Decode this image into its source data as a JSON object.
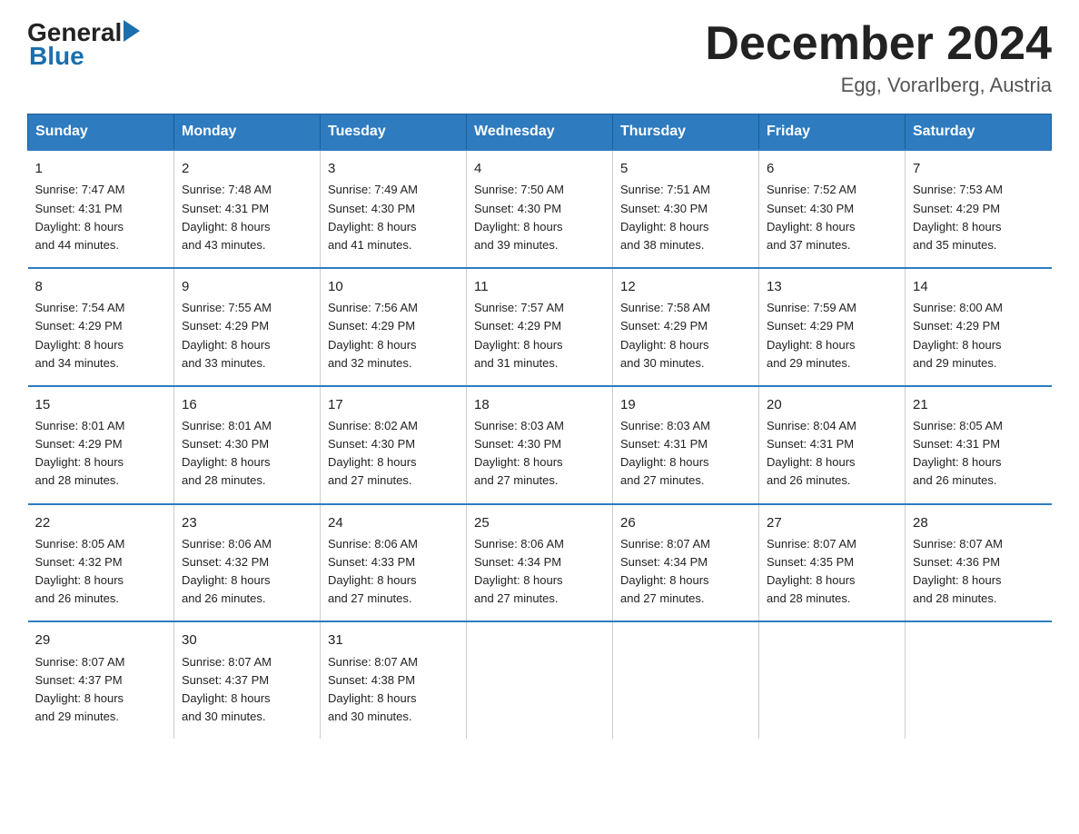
{
  "logo": {
    "general": "General",
    "arrow": "",
    "blue": "Blue"
  },
  "title": "December 2024",
  "location": "Egg, Vorarlberg, Austria",
  "days_of_week": [
    "Sunday",
    "Monday",
    "Tuesday",
    "Wednesday",
    "Thursday",
    "Friday",
    "Saturday"
  ],
  "weeks": [
    [
      {
        "day": "1",
        "info": "Sunrise: 7:47 AM\nSunset: 4:31 PM\nDaylight: 8 hours\nand 44 minutes."
      },
      {
        "day": "2",
        "info": "Sunrise: 7:48 AM\nSunset: 4:31 PM\nDaylight: 8 hours\nand 43 minutes."
      },
      {
        "day": "3",
        "info": "Sunrise: 7:49 AM\nSunset: 4:30 PM\nDaylight: 8 hours\nand 41 minutes."
      },
      {
        "day": "4",
        "info": "Sunrise: 7:50 AM\nSunset: 4:30 PM\nDaylight: 8 hours\nand 39 minutes."
      },
      {
        "day": "5",
        "info": "Sunrise: 7:51 AM\nSunset: 4:30 PM\nDaylight: 8 hours\nand 38 minutes."
      },
      {
        "day": "6",
        "info": "Sunrise: 7:52 AM\nSunset: 4:30 PM\nDaylight: 8 hours\nand 37 minutes."
      },
      {
        "day": "7",
        "info": "Sunrise: 7:53 AM\nSunset: 4:29 PM\nDaylight: 8 hours\nand 35 minutes."
      }
    ],
    [
      {
        "day": "8",
        "info": "Sunrise: 7:54 AM\nSunset: 4:29 PM\nDaylight: 8 hours\nand 34 minutes."
      },
      {
        "day": "9",
        "info": "Sunrise: 7:55 AM\nSunset: 4:29 PM\nDaylight: 8 hours\nand 33 minutes."
      },
      {
        "day": "10",
        "info": "Sunrise: 7:56 AM\nSunset: 4:29 PM\nDaylight: 8 hours\nand 32 minutes."
      },
      {
        "day": "11",
        "info": "Sunrise: 7:57 AM\nSunset: 4:29 PM\nDaylight: 8 hours\nand 31 minutes."
      },
      {
        "day": "12",
        "info": "Sunrise: 7:58 AM\nSunset: 4:29 PM\nDaylight: 8 hours\nand 30 minutes."
      },
      {
        "day": "13",
        "info": "Sunrise: 7:59 AM\nSunset: 4:29 PM\nDaylight: 8 hours\nand 29 minutes."
      },
      {
        "day": "14",
        "info": "Sunrise: 8:00 AM\nSunset: 4:29 PM\nDaylight: 8 hours\nand 29 minutes."
      }
    ],
    [
      {
        "day": "15",
        "info": "Sunrise: 8:01 AM\nSunset: 4:29 PM\nDaylight: 8 hours\nand 28 minutes."
      },
      {
        "day": "16",
        "info": "Sunrise: 8:01 AM\nSunset: 4:30 PM\nDaylight: 8 hours\nand 28 minutes."
      },
      {
        "day": "17",
        "info": "Sunrise: 8:02 AM\nSunset: 4:30 PM\nDaylight: 8 hours\nand 27 minutes."
      },
      {
        "day": "18",
        "info": "Sunrise: 8:03 AM\nSunset: 4:30 PM\nDaylight: 8 hours\nand 27 minutes."
      },
      {
        "day": "19",
        "info": "Sunrise: 8:03 AM\nSunset: 4:31 PM\nDaylight: 8 hours\nand 27 minutes."
      },
      {
        "day": "20",
        "info": "Sunrise: 8:04 AM\nSunset: 4:31 PM\nDaylight: 8 hours\nand 26 minutes."
      },
      {
        "day": "21",
        "info": "Sunrise: 8:05 AM\nSunset: 4:31 PM\nDaylight: 8 hours\nand 26 minutes."
      }
    ],
    [
      {
        "day": "22",
        "info": "Sunrise: 8:05 AM\nSunset: 4:32 PM\nDaylight: 8 hours\nand 26 minutes."
      },
      {
        "day": "23",
        "info": "Sunrise: 8:06 AM\nSunset: 4:32 PM\nDaylight: 8 hours\nand 26 minutes."
      },
      {
        "day": "24",
        "info": "Sunrise: 8:06 AM\nSunset: 4:33 PM\nDaylight: 8 hours\nand 27 minutes."
      },
      {
        "day": "25",
        "info": "Sunrise: 8:06 AM\nSunset: 4:34 PM\nDaylight: 8 hours\nand 27 minutes."
      },
      {
        "day": "26",
        "info": "Sunrise: 8:07 AM\nSunset: 4:34 PM\nDaylight: 8 hours\nand 27 minutes."
      },
      {
        "day": "27",
        "info": "Sunrise: 8:07 AM\nSunset: 4:35 PM\nDaylight: 8 hours\nand 28 minutes."
      },
      {
        "day": "28",
        "info": "Sunrise: 8:07 AM\nSunset: 4:36 PM\nDaylight: 8 hours\nand 28 minutes."
      }
    ],
    [
      {
        "day": "29",
        "info": "Sunrise: 8:07 AM\nSunset: 4:37 PM\nDaylight: 8 hours\nand 29 minutes."
      },
      {
        "day": "30",
        "info": "Sunrise: 8:07 AM\nSunset: 4:37 PM\nDaylight: 8 hours\nand 30 minutes."
      },
      {
        "day": "31",
        "info": "Sunrise: 8:07 AM\nSunset: 4:38 PM\nDaylight: 8 hours\nand 30 minutes."
      },
      {
        "day": "",
        "info": ""
      },
      {
        "day": "",
        "info": ""
      },
      {
        "day": "",
        "info": ""
      },
      {
        "day": "",
        "info": ""
      }
    ]
  ]
}
